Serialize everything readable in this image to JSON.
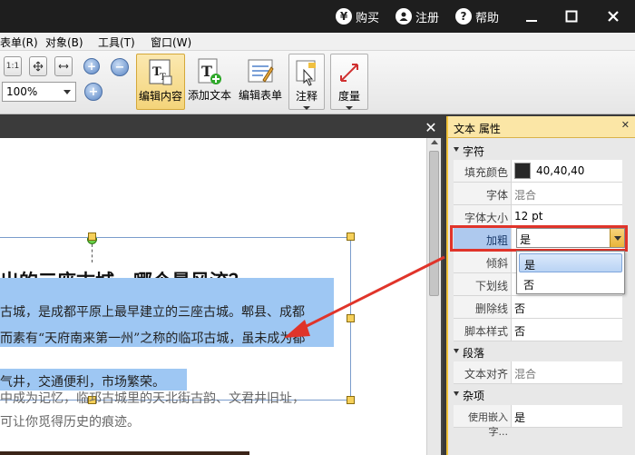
{
  "titlebar": {
    "buy_icon": "yen-icon",
    "buy": "购买",
    "register_icon": "user-icon",
    "register": "注册",
    "help_icon": "question-icon",
    "help": "帮助"
  },
  "menu": {
    "items": [
      "表单(R)",
      "对象(B)",
      "工具(T)",
      "窗口(W)"
    ]
  },
  "toolbar": {
    "actual_size": "1:1",
    "zoom_value": "100%",
    "edit_content": "编辑内容",
    "add_text": "添加文本",
    "edit_form": "编辑表单",
    "comment": "注释",
    "measure": "度量"
  },
  "document": {
    "heading": "出的三座古城，哪个最风流？",
    "lines": [
      "古城，是成都平原上最早建立的三座古城。郫县、成都",
      "而素有“天府南来第一州”之称的临邛古城，虽未成为都",
      "气井，交通便利，市场繁荣。",
      "中成为记忆，临邛古城里的天北街古韵、文君井旧址，",
      "可让你觅得历史的痕迹。"
    ]
  },
  "panel": {
    "title": "文本 属性",
    "sections": {
      "character": "字符",
      "paragraph": "段落",
      "misc": "杂项"
    },
    "rows": {
      "fill_color_label": "填充颜色",
      "fill_color_value": "40,40,40",
      "font_label": "字体",
      "font_value": "混合",
      "font_size_label": "字体大小",
      "font_size_value": "12 pt",
      "bold_label": "加粗",
      "bold_value": "是",
      "italic_label": "倾斜",
      "underline_label": "下划线",
      "strikethrough_label": "删除线",
      "strikethrough_value": "否",
      "script_label": "脚本样式",
      "script_value": "否",
      "align_label": "文本对齐",
      "align_value": "混合",
      "embedded_label": "使用嵌入字...",
      "embedded_value": "是"
    },
    "dropdown_options": [
      "是",
      "否"
    ]
  },
  "colors": {
    "accent_highlight": "#e0342a",
    "selection": "#9ec7f3",
    "panel_title_bg": "#fbe6a6"
  }
}
